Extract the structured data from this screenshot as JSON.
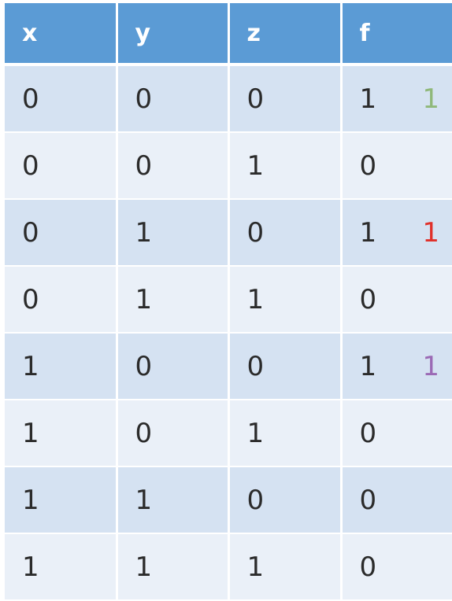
{
  "table": {
    "headers": [
      "x",
      "y",
      "z",
      "f"
    ],
    "rows": [
      {
        "x": "0",
        "y": "0",
        "z": "0",
        "f": "1",
        "mark": "1",
        "mark_color": "#8fb87a"
      },
      {
        "x": "0",
        "y": "0",
        "z": "1",
        "f": "0",
        "mark": "",
        "mark_color": ""
      },
      {
        "x": "0",
        "y": "1",
        "z": "0",
        "f": "1",
        "mark": "1",
        "mark_color": "#e0302a"
      },
      {
        "x": "0",
        "y": "1",
        "z": "1",
        "f": "0",
        "mark": "",
        "mark_color": ""
      },
      {
        "x": "1",
        "y": "0",
        "z": "0",
        "f": "1",
        "mark": "1",
        "mark_color": "#9b6ab5"
      },
      {
        "x": "1",
        "y": "0",
        "z": "1",
        "f": "0",
        "mark": "",
        "mark_color": ""
      },
      {
        "x": "1",
        "y": "1",
        "z": "0",
        "f": "0",
        "mark": "",
        "mark_color": ""
      },
      {
        "x": "1",
        "y": "1",
        "z": "1",
        "f": "0",
        "mark": "",
        "mark_color": ""
      }
    ]
  },
  "colors": {
    "header_bg": "#5b9bd5",
    "row_odd_bg": "#d5e2f2",
    "row_even_bg": "#eaf0f8"
  }
}
